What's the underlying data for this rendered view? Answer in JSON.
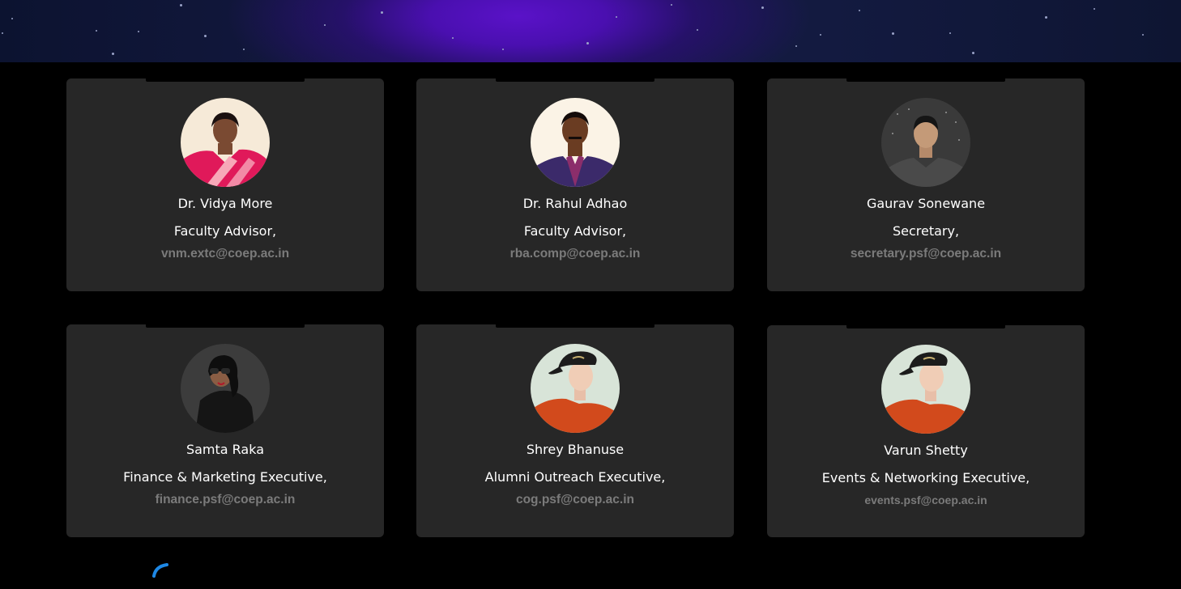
{
  "members": [
    {
      "name": "Dr. Vidya More",
      "role": "Faculty Advisor,",
      "email": "vnm.extc@coep.ac.in",
      "avatar": "faculty-portrait-saree"
    },
    {
      "name": "Dr. Rahul Adhao",
      "role": "Faculty Advisor,",
      "email": "rba.comp@coep.ac.in",
      "avatar": "faculty-portrait-formal"
    },
    {
      "name": "Gaurav Sonewane",
      "role": "Secretary,",
      "email": "secretary.psf@coep.ac.in",
      "avatar": "student-portrait"
    },
    {
      "name": "Samta Raka",
      "role": "Finance & Marketing Executive,",
      "email": "finance.psf@coep.ac.in",
      "avatar": "portrait-sunglasses"
    },
    {
      "name": "Shrey Bhanuse",
      "role": "Alumni Outreach Executive,",
      "email": "cog.psf@coep.ac.in",
      "avatar": "portrait-cap-orange-sweater"
    },
    {
      "name": "Varun Shetty",
      "role": "Events & Networking Executive,",
      "email": "events.psf@coep.ac.in",
      "avatar": "portrait-cap-orange-sweater"
    }
  ],
  "colors": {
    "card_bg": "#272727",
    "page_bg": "#000000",
    "email_text": "#7b7b7b",
    "banner_glow": "#5a12c8"
  }
}
